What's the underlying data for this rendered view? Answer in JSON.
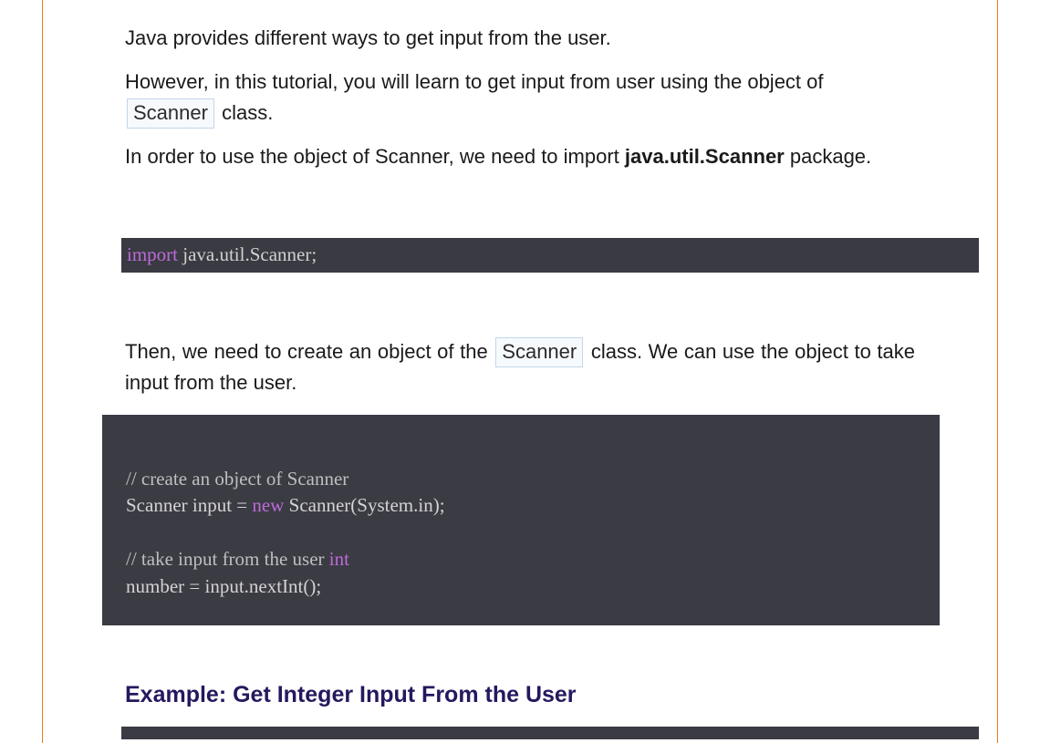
{
  "paragraph1": "Java provides different ways to get input from the user.",
  "paragraph2_a": "However, in this tutorial, you will learn to get input from user using the object of ",
  "scanner_inline1": "Scanner",
  "paragraph2_b": " class.",
  "paragraph3_a": "In order to use the object of Scanner, we need to import ",
  "paragraph3_bold": "java.util.Scanner",
  "paragraph3_b": " package.",
  "code1_import": "import",
  "code1_rest": " java.util.Scanner;",
  "paragraph4_a": "Then, we need to create an object of the ",
  "scanner_inline2": "Scanner",
  "paragraph4_b": " class. We can use the object to take input from the user.",
  "code2_comment1": "// create an object of Scanner",
  "code2_line1_a": "Scanner input = ",
  "code2_line1_new": "new",
  "code2_line1_b": " Scanner(System.in);",
  "code2_comment2": "// take input from the user ",
  "code2_int": "int",
  "code2_line2": "number = input.nextInt();",
  "heading": "Example: Get Integer Input From the User"
}
